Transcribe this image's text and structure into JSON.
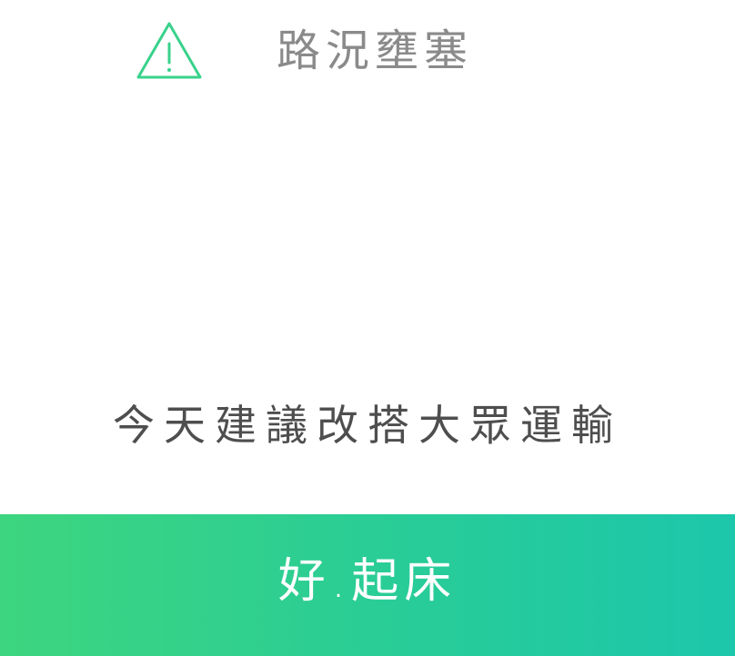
{
  "alert": {
    "icon": "warning-triangle-icon",
    "title": "路況壅塞",
    "accent_color": "#38d28b"
  },
  "suggestion": {
    "text": "今天建議改搭大眾運輸"
  },
  "action_bar": {
    "label": "好.起床",
    "gradient_start": "#3dd57f",
    "gradient_end": "#1cc7ab"
  }
}
